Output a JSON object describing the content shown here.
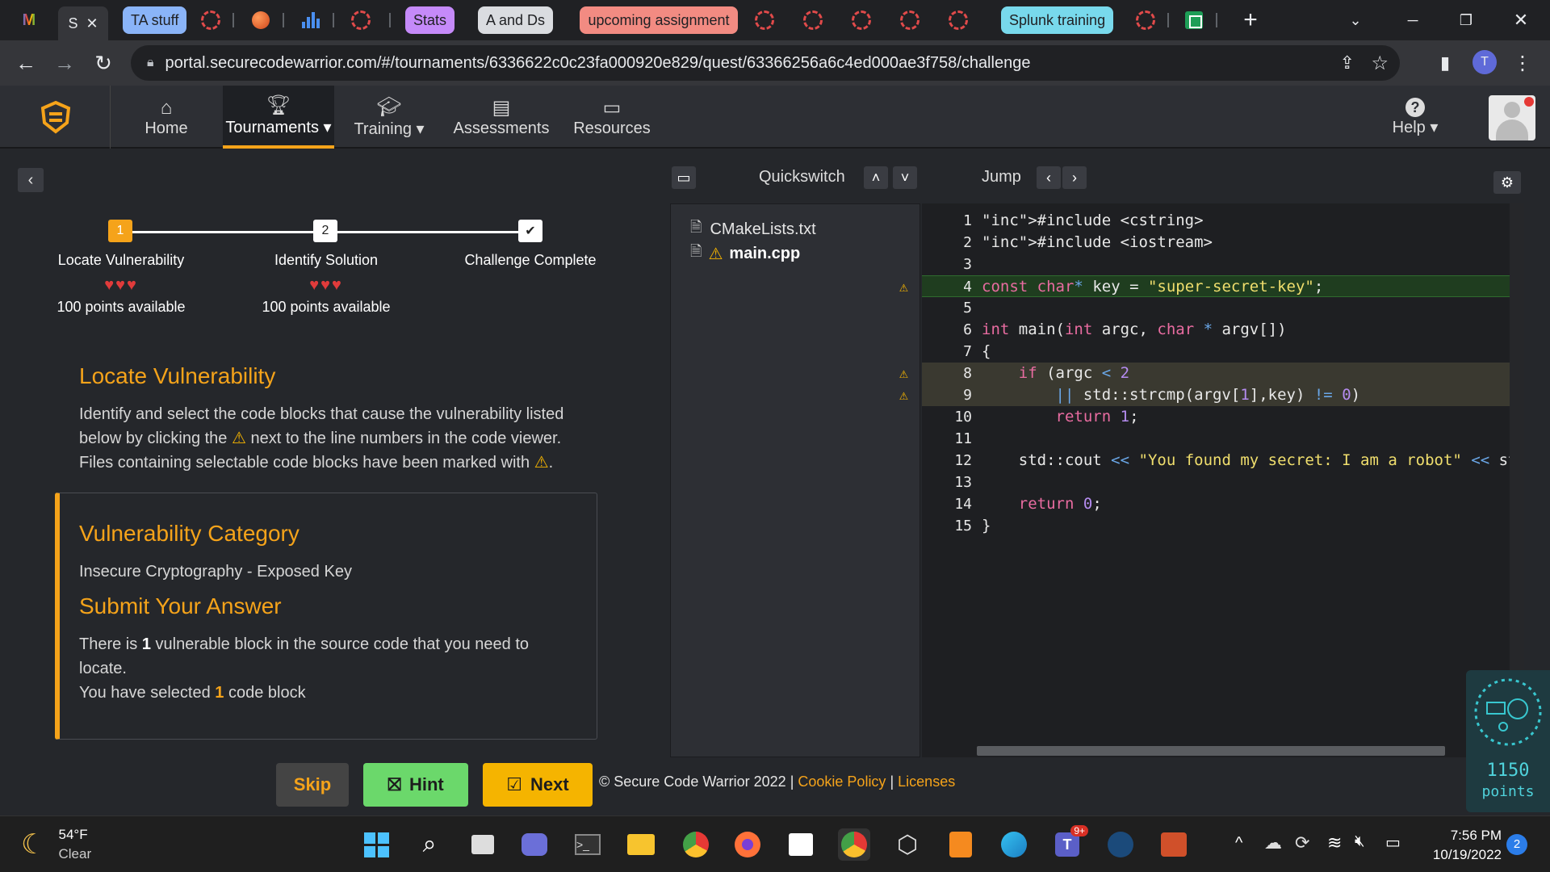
{
  "browser": {
    "tabs": [
      {
        "label": "M",
        "kind": "gmail"
      },
      {
        "label": "S",
        "kind": "active"
      },
      {
        "label": "TA stuff",
        "color": "#8ab4f8"
      },
      {
        "label": "Stats",
        "color": "#c58af9"
      },
      {
        "label": "A and Ds",
        "color": "#dadce0"
      },
      {
        "label": "upcoming assignment",
        "color": "#f28b82"
      },
      {
        "label": "Splunk training",
        "color": "#78d9ec"
      }
    ],
    "url": "portal.securecodewarrior.com/#/tournaments/6336622c0c23fa000920e829/quest/63366256a6c4ed000ae3f758/challenge",
    "profile_letter": "T"
  },
  "nav": {
    "items": [
      {
        "label": "Home",
        "icon": "home-icon"
      },
      {
        "label": "Tournaments",
        "icon": "trophy-icon",
        "active": true
      },
      {
        "label": "Training",
        "icon": "graduation-cap-icon"
      },
      {
        "label": "Assessments",
        "icon": "document-icon"
      },
      {
        "label": "Resources",
        "icon": "presentation-icon"
      }
    ],
    "help_label": "Help"
  },
  "steps": [
    {
      "num": "1",
      "label": "Locate Vulnerability",
      "points": "100 points available",
      "hearts": 3
    },
    {
      "num": "2",
      "label": "Identify Solution",
      "points": "100 points available",
      "hearts": 3
    },
    {
      "num": "✔",
      "label": "Challenge Complete"
    }
  ],
  "locate": {
    "heading": "Locate Vulnerability",
    "line1": "Identify and select the code blocks that cause the vulnerability listed",
    "line2a": "below by clicking the",
    "line2b": "next to the line numbers in the code viewer.",
    "line3a": "Files containing selectable code blocks have been marked with",
    "line3b": "."
  },
  "category": {
    "heading": "Vulnerability Category",
    "value": "Insecure Cryptography - Exposed Key",
    "submit_heading": "Submit Your Answer",
    "line1a": "There is",
    "line1_count": "1",
    "line1b": "vulnerable block in the source code that you need to",
    "line2": "locate.",
    "line3a": "You have selected",
    "line3_count": "1",
    "line3b": "code block"
  },
  "buttons": {
    "skip": "Skip",
    "hint": "Hint",
    "next": "Next"
  },
  "footer": {
    "copyright": "© Secure Code Warrior 2022 |",
    "cookie": "Cookie Policy",
    "sep": "|",
    "licenses": "Licenses"
  },
  "toolbar": {
    "quickswitch": "Quickswitch",
    "jump": "Jump"
  },
  "files": [
    {
      "name": "CMakeLists.txt",
      "warn": false
    },
    {
      "name": "main.cpp",
      "warn": true
    }
  ],
  "code": [
    {
      "n": "1",
      "text": "#include <cstring>"
    },
    {
      "n": "2",
      "text": "#include <iostream>"
    },
    {
      "n": "3",
      "text": ""
    },
    {
      "n": "4",
      "text": "const char* key = \"super-secret-key\";",
      "warn": true,
      "selected": true
    },
    {
      "n": "5",
      "text": ""
    },
    {
      "n": "6",
      "text": "int main(int argc, char * argv[])"
    },
    {
      "n": "7",
      "text": "{"
    },
    {
      "n": "8",
      "text": "    if (argc < 2",
      "warn": true,
      "highlight": true
    },
    {
      "n": "9",
      "text": "        || std::strcmp(argv[1],key) != 0)",
      "warn": true,
      "highlight": true
    },
    {
      "n": "10",
      "text": "        return 1;"
    },
    {
      "n": "11",
      "text": ""
    },
    {
      "n": "12",
      "text": "    std::cout << \"You found my secret: I am a robot\" << st"
    },
    {
      "n": "13",
      "text": ""
    },
    {
      "n": "14",
      "text": "    return 0;"
    },
    {
      "n": "15",
      "text": "}"
    }
  ],
  "score": {
    "value": "1150",
    "unit": "points"
  },
  "taskbar": {
    "weather_temp": "54°F",
    "weather_desc": "Clear",
    "time": "7:56 PM",
    "date": "10/19/2022",
    "notif_count": "2",
    "teams_badge": "9+"
  }
}
